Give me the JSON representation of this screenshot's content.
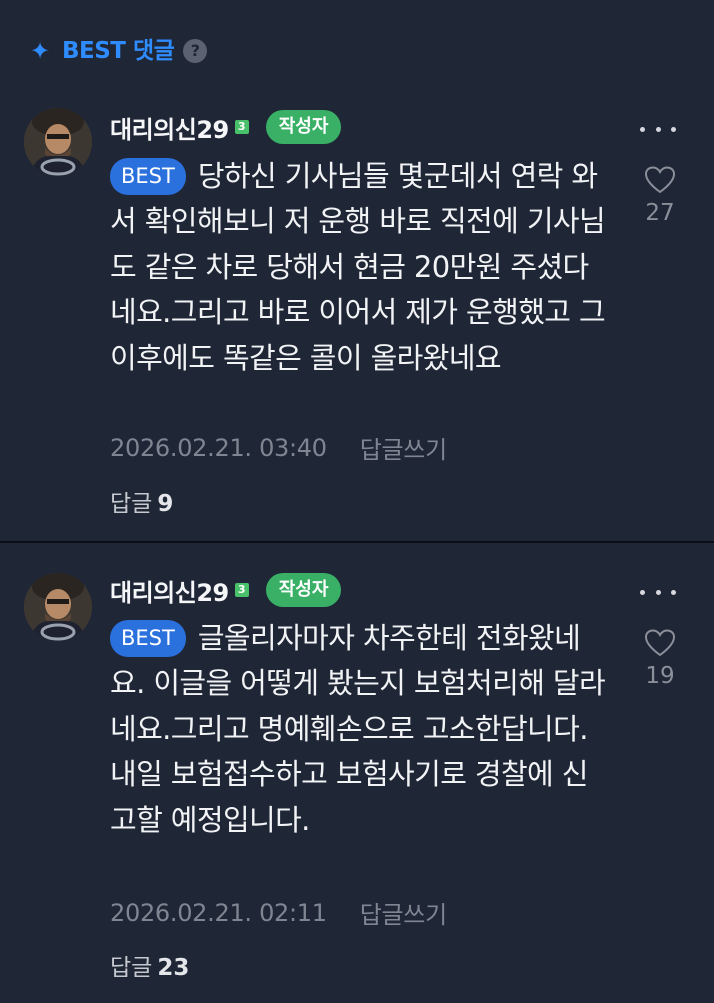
{
  "header": {
    "icon": "sparkle-icon",
    "title": "BEST 댓글",
    "help": "?"
  },
  "colors": {
    "background": "#1f2636",
    "accent": "#2f8cff",
    "best_badge": "#2a71dd",
    "author_badge": "#39b065",
    "level_badge": "#49c06a"
  },
  "comments": [
    {
      "author": "대리의신29",
      "level": "3",
      "author_badge": "작성자",
      "best_label": "BEST",
      "text": "당하신 기사님들 몇군데서 연락 와서 확인해보니 저 운행 바로 직전에 기사님도 같은 차로 당해서 현금 20만원 주셨다네요.그리고 바로 이어서 제가 운행했고 그 이후에도 똑같은 콜이 올라왔네요",
      "likes": "27",
      "date": "2026.02.21. 03:40",
      "reply_link": "답글쓰기",
      "replies_label": "답글",
      "replies_count": "9"
    },
    {
      "author": "대리의신29",
      "level": "3",
      "author_badge": "작성자",
      "best_label": "BEST",
      "text": "글올리자마자 차주한테 전화왔네요. 이글을 어떻게 봤는지 보험처리해 달라네요.그리고 명예훼손으로 고소한답니다.",
      "text2": "내일 보험접수하고 보험사기로 경찰에 신고할 예정입니다.",
      "likes": "19",
      "date": "2026.02.21. 02:11",
      "reply_link": "답글쓰기",
      "replies_label": "답글",
      "replies_count": "23"
    }
  ]
}
